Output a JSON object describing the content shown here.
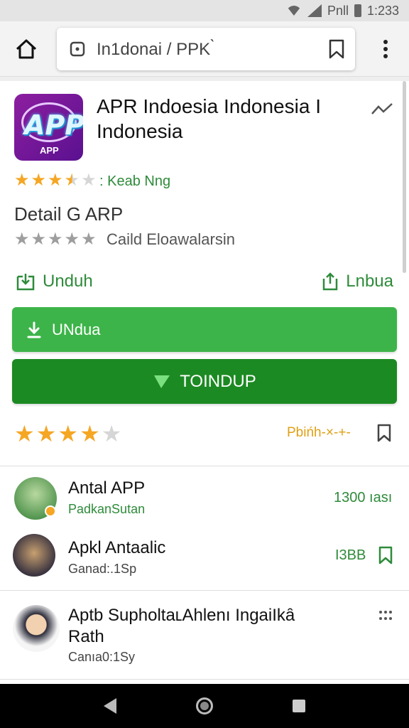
{
  "status_bar": {
    "carrier": "Pnll",
    "time": "1:233"
  },
  "browser": {
    "url": "Ιn1donai / PPK ̀"
  },
  "app": {
    "title": "APR Indoesia Indonesia I Indonesia",
    "icon_text": "APP",
    "icon_subtext": "APP",
    "rating_text": ": Keab Nng",
    "detail_title": "Detail G ARP",
    "detail_subtitle": "Caild Eloawalarsin",
    "link_left": "Unduh",
    "link_right": "Lnbua",
    "button_primary": "UNdua",
    "button_secondary": "TOINDUP",
    "rating_right_text": "Pbińh-×-+-"
  },
  "colors": {
    "accent_green": "#2e8b3a",
    "button_green": "#3db449",
    "button_dark_green": "#1c8a22",
    "star_gold": "#f5a623",
    "star_grey": "#9e9e9e"
  },
  "ratings": {
    "top_stars": 3.5,
    "grey_stars": 5,
    "big_stars": 4
  },
  "list": [
    {
      "title": "Antal APP",
      "subtitle": "PadkanSutan",
      "meta": "1300 ıası"
    },
    {
      "title": "Apkl Antaalic",
      "subtitle": "Ganad:.1Sp",
      "meta": "I3BB"
    },
    {
      "title": "Aptb SupholtaʟAhlenı IngaiIkȃ Rath",
      "subtitle": "Canıa0:1Sy",
      "meta": ""
    }
  ],
  "icons": {
    "home": "home-icon",
    "lock": "lock-icon",
    "bookmark": "bookmark-icon",
    "menu": "more-vert-icon",
    "trend": "trending-icon",
    "download": "download-icon",
    "share": "share-icon",
    "play": "play-icon",
    "grid_menu": "dots-grid-icon"
  }
}
